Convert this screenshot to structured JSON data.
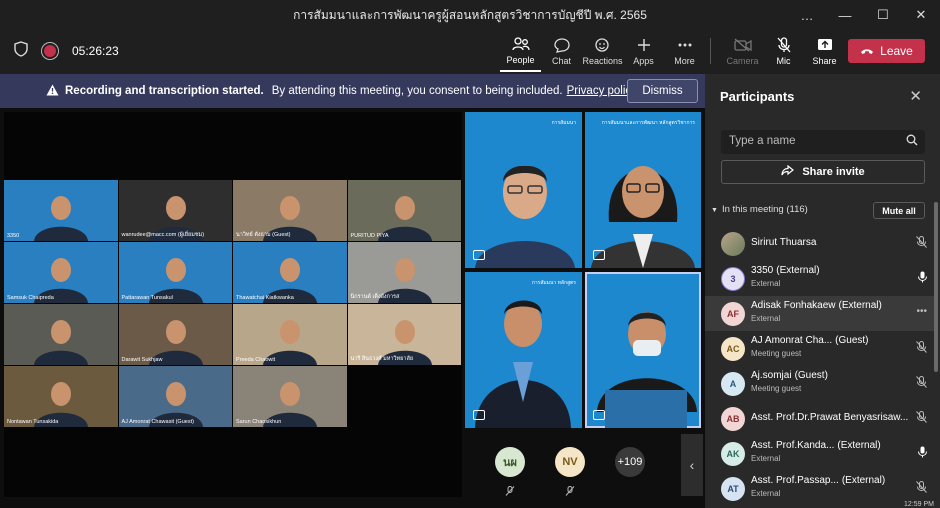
{
  "window": {
    "title": "การสัมมนาและการพัฒนาครูผู้สอนหลักสูตรวิชาการบัญชีปี พ.ศ. 2565",
    "controls": [
      "…",
      "—",
      "☐",
      "✕"
    ]
  },
  "toolbar": {
    "timer": "05:26:23",
    "buttons": [
      {
        "label": "People",
        "icon": "people-icon"
      },
      {
        "label": "Chat",
        "icon": "chat-icon"
      },
      {
        "label": "Reactions",
        "icon": "reactions-icon"
      },
      {
        "label": "Apps",
        "icon": "apps-icon"
      },
      {
        "label": "More",
        "icon": "more-icon"
      },
      {
        "label": "Camera",
        "icon": "camera-off-icon"
      },
      {
        "label": "Mic",
        "icon": "mic-off-icon"
      },
      {
        "label": "Share",
        "icon": "share-icon"
      }
    ],
    "leave_label": "Leave",
    "leave_color": "#c4314b"
  },
  "banner": {
    "bold": "Recording and transcription started.",
    "text": "By attending this meeting, you consent to being included.",
    "link": "Privacy policy",
    "dismiss": "Dismiss"
  },
  "gallery": {
    "tiles": [
      {
        "name": "3350",
        "color": "#2a7fc0"
      },
      {
        "name": "wanrudee@macc.com (ผู้เยี่ยมชม)",
        "color": "#2e2e2e"
      },
      {
        "name": "นาวิทย์ ตังธาม (Guest)",
        "color": "#8a7a66"
      },
      {
        "name": "PURITUD PIYA",
        "color": "#6b6b5c"
      },
      {
        "name": "Samsuk Chaipreda",
        "color": "#2a7fc0"
      },
      {
        "name": "Pattarawan Tunsakul",
        "color": "#2a7fc0"
      },
      {
        "name": "Thawatchai Kiatkwanka",
        "color": "#2a7fc0"
      },
      {
        "name": "นิกรานต์ เต็งอังการส",
        "color": "#9a9a96"
      },
      {
        "name": "",
        "color": "#5b5b55"
      },
      {
        "name": "Darawit Sukhjaw",
        "color": "#6b5a47"
      },
      {
        "name": "Preeda Chaowit",
        "color": "#b8a68a"
      },
      {
        "name": "นารี สินธวงศ์ มหาวิทยาลัย",
        "color": "#c9b59a"
      },
      {
        "name": "Nontawan Tunsakida",
        "color": "#6b5a3e"
      },
      {
        "name": "AJ Amonrat Chawasit (Guest)",
        "color": "#4a6a8a"
      },
      {
        "name": "Sarun Chaosikhun",
        "color": "#8a8378"
      }
    ],
    "big_tiles": [
      {
        "slide": "การสัมมนา"
      },
      {
        "slide": "การสัมมนาและการพัฒนา หลักสูตรวิชาการ"
      },
      {
        "slide": "การสัมมนา หลักสูตร"
      },
      {
        "slide": ""
      }
    ],
    "overflow": [
      {
        "initials": "นผ",
        "color": "#d8e7d0",
        "text_color": "#3c5a2c"
      },
      {
        "initials": "NV",
        "color": "#f4e6c6",
        "text_color": "#7a5a1c"
      },
      {
        "initials": "+109",
        "color": "#3a3a3a",
        "text_color": "#ffffff"
      }
    ]
  },
  "participants": {
    "title": "Participants",
    "search_placeholder": "Type a name",
    "share_invite": "Share invite",
    "section": "In this meeting (116)",
    "mute_all": "Mute all",
    "items": [
      {
        "name": "Sirirut Thuarsa",
        "tag": "",
        "sub": "",
        "initials": "",
        "color": "#8a9a7a",
        "text_color": "#ffffff",
        "mic": "mic-off-icon"
      },
      {
        "name": "3350",
        "tag": "(External)",
        "sub": "External",
        "initials": "3",
        "color": "#e4e1f4",
        "text_color": "#4a3f8a",
        "mic": "mic-on-icon"
      },
      {
        "name": "Adisak Fonhakaew",
        "tag": "(External)",
        "sub": "External",
        "initials": "AF",
        "color": "#f2d6d6",
        "text_color": "#8a3030",
        "mic": "more-icon"
      },
      {
        "name": "AJ Amonrat Cha...",
        "tag": "(Guest)",
        "sub": "Meeting guest",
        "initials": "AC",
        "color": "#f4e6c6",
        "text_color": "#7a5a1c",
        "mic": "mic-off-icon"
      },
      {
        "name": "Aj.somjai",
        "tag": "(Guest)",
        "sub": "Meeting guest",
        "initials": "A",
        "color": "#d6e8f2",
        "text_color": "#2c5a7a",
        "mic": "mic-off-icon"
      },
      {
        "name": "Asst. Prof.Dr.Prawat Benyasrisaw...",
        "tag": "",
        "sub": "",
        "initials": "AB",
        "color": "#f2d6d6",
        "text_color": "#8a3030",
        "mic": "mic-off-icon"
      },
      {
        "name": "Asst. Prof.Kanda...",
        "tag": "(External)",
        "sub": "External",
        "initials": "AK",
        "color": "#d6ece6",
        "text_color": "#2c6a5a",
        "mic": "mic-on-icon"
      },
      {
        "name": "Asst. Prof.Passap...",
        "tag": "(External)",
        "sub": "External",
        "initials": "AT",
        "color": "#d6e3f2",
        "text_color": "#2c4a7a",
        "mic": "mic-off-icon"
      }
    ]
  },
  "clock": "12:59 PM"
}
